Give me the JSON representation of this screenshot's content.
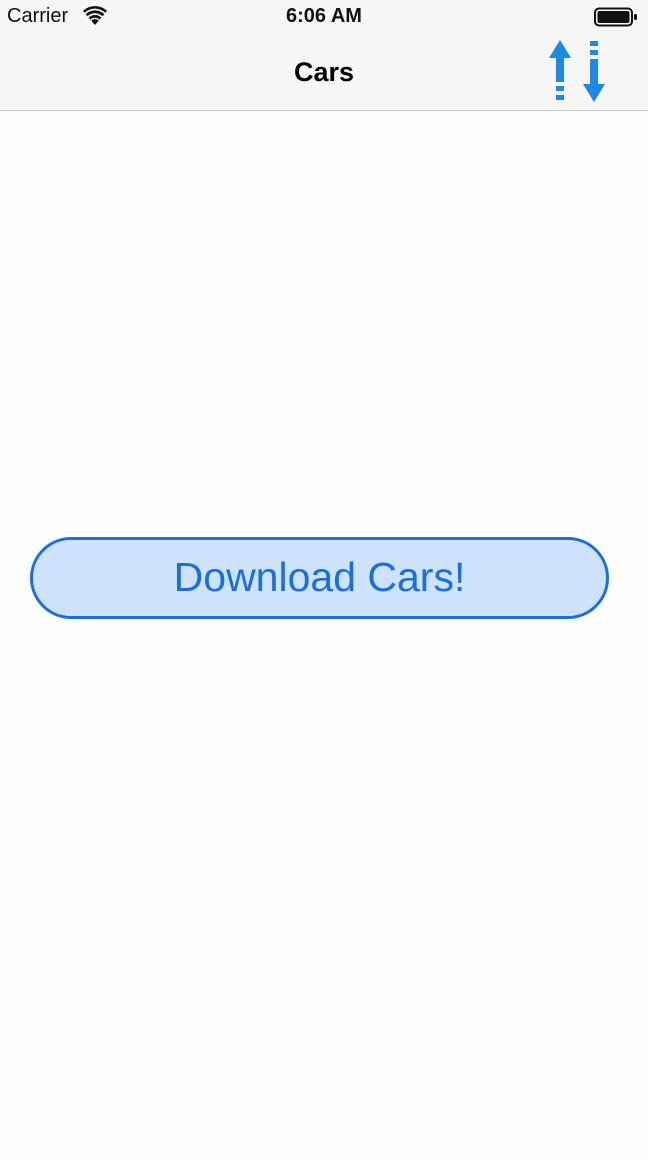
{
  "status_bar": {
    "carrier": "Carrier",
    "time": "6:06 AM",
    "wifi_icon": "wifi-icon",
    "battery_icon": "battery-icon"
  },
  "nav_bar": {
    "title": "Cars",
    "sort_icon": "sort-arrows-icon"
  },
  "main": {
    "download_button_label": "Download Cars!"
  },
  "colors": {
    "accent": "#1a6fe0",
    "icon_blue": "#1e88e5",
    "button_fill": "#cfe2fb",
    "bar_background": "#f6f6f6",
    "page_background": "#fdfdfd"
  }
}
